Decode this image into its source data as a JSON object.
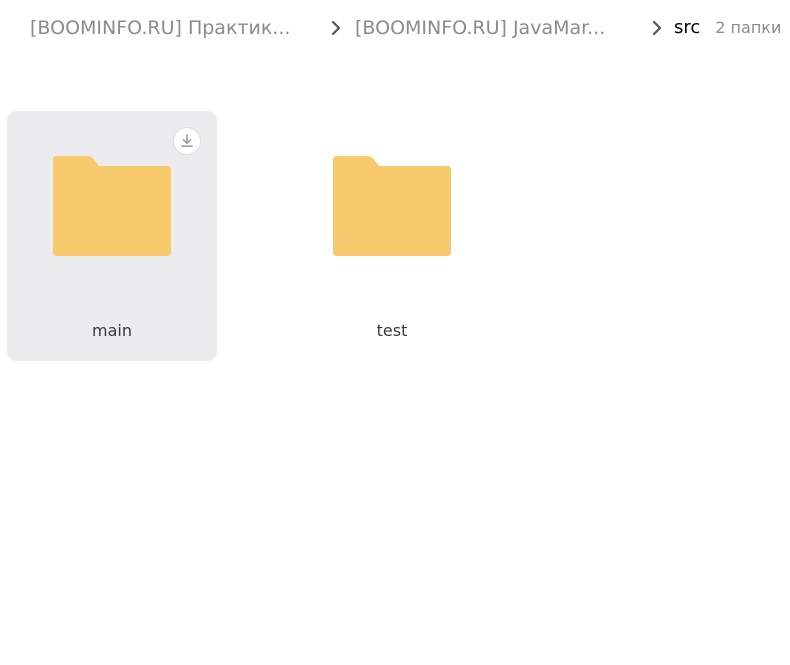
{
  "breadcrumb": {
    "items": [
      {
        "label": "[BOOMINFO.RU] Практик..."
      },
      {
        "label": "[BOOMINFO.RU] JavaMar..."
      }
    ],
    "current": "src",
    "count": "2 папки"
  },
  "folders": [
    {
      "name": "main",
      "selected": true
    },
    {
      "name": "test",
      "selected": false
    }
  ],
  "colors": {
    "folder": "#f7ca6b",
    "folder_tab": "#f7ca6b",
    "selected_bg": "#ececef",
    "breadcrumb_text": "#8b8b8b"
  }
}
